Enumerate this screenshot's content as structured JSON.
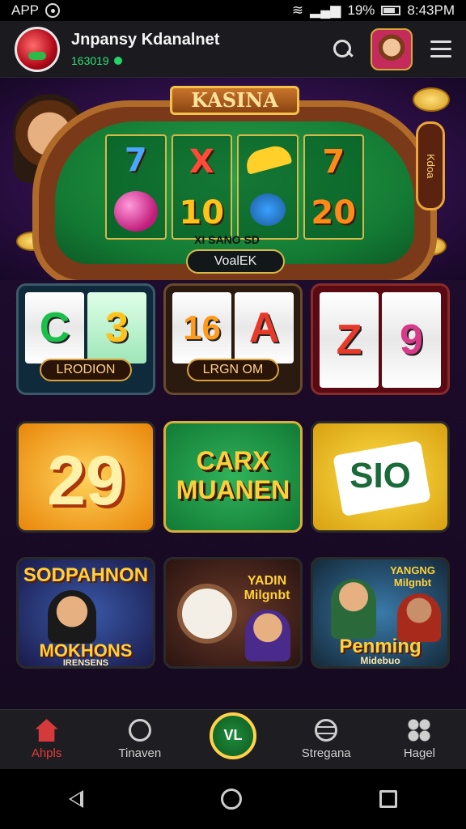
{
  "status": {
    "app_label": "APP",
    "battery": "19%",
    "time": "8:43PM"
  },
  "header": {
    "title": "Jnpansy Kdanalnet",
    "subtitle": "163019"
  },
  "hero": {
    "banner": "KASINA",
    "sub": "XI SANO SD",
    "button": "VoalEK",
    "side_badge": "Kdoa"
  },
  "reels": [
    [
      "7",
      "",
      ""
    ],
    [
      "X",
      "10",
      ""
    ],
    [
      "",
      "",
      ""
    ],
    [
      "7",
      "20",
      ""
    ]
  ],
  "cards": [
    {
      "label": "LRODION",
      "reels": [
        "C",
        "3"
      ]
    },
    {
      "label": "LRGN OM",
      "reels": [
        "16",
        "A"
      ]
    },
    {
      "label": "",
      "reels": [
        "Z",
        "9"
      ]
    },
    {
      "label": "29"
    },
    {
      "label": "CARX MUANEN"
    },
    {
      "label": "SIO"
    },
    {
      "title": "SODPAHNON",
      "label": "MOKHONS",
      "sub": "IRENSENS"
    },
    {
      "title": "YADIN Milgnbt"
    },
    {
      "title": "YANGNG Milgnbt",
      "label": "Penming",
      "sub": "Midebuo"
    }
  ],
  "nav": {
    "items": [
      {
        "label": "Ahpls"
      },
      {
        "label": "Tinaven"
      },
      {
        "label": "VL"
      },
      {
        "label": "Stregana"
      },
      {
        "label": "Hagel"
      }
    ]
  },
  "colors": {
    "accent": "#e63b3b",
    "green": "#22d36a",
    "gold": "#ffd24a"
  }
}
